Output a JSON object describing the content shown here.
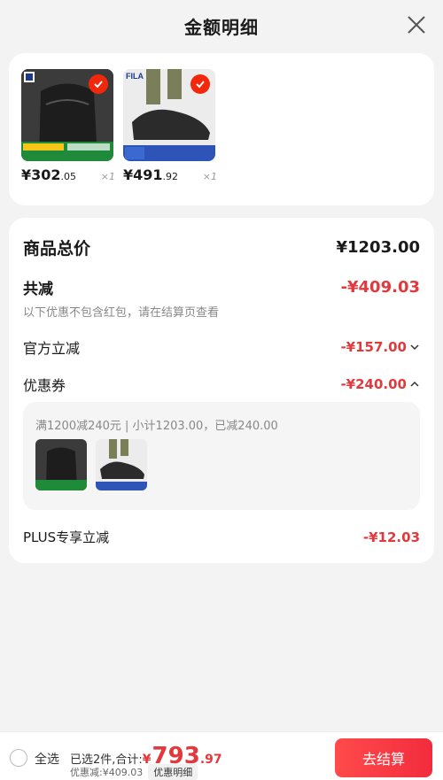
{
  "header": {
    "title": "金额明细"
  },
  "products": [
    {
      "price_int": "¥302",
      "price_dec": ".05",
      "qty": "×1"
    },
    {
      "price_int": "¥491",
      "price_dec": ".92",
      "qty": "×1"
    }
  ],
  "detail": {
    "total_label": "商品总价",
    "total_value": "¥1203.00",
    "discount_label": "共减",
    "discount_value": "-¥409.03",
    "hint": "以下优惠不包含红包，请在结算页查看",
    "official_label": "官方立减",
    "official_value": "-¥157.00",
    "coupon_label": "优惠券",
    "coupon_value": "-¥240.00",
    "coupon_desc": "满1200减240元 | 小计1203.00，已减240.00",
    "plus_label": "PLUS专享立减",
    "plus_value": "-¥12.03"
  },
  "bottom": {
    "select_all": "全选",
    "summary_prefix": "已选2件,合计:",
    "total_sym": "¥",
    "total_int": "793",
    "total_dec": ".97",
    "discount_text": "优惠减:¥409.03",
    "detail_chip": "优惠明细",
    "checkout": "去结算"
  },
  "colors": {
    "accent": "#e4393c",
    "checkout": "#f22c3d"
  }
}
